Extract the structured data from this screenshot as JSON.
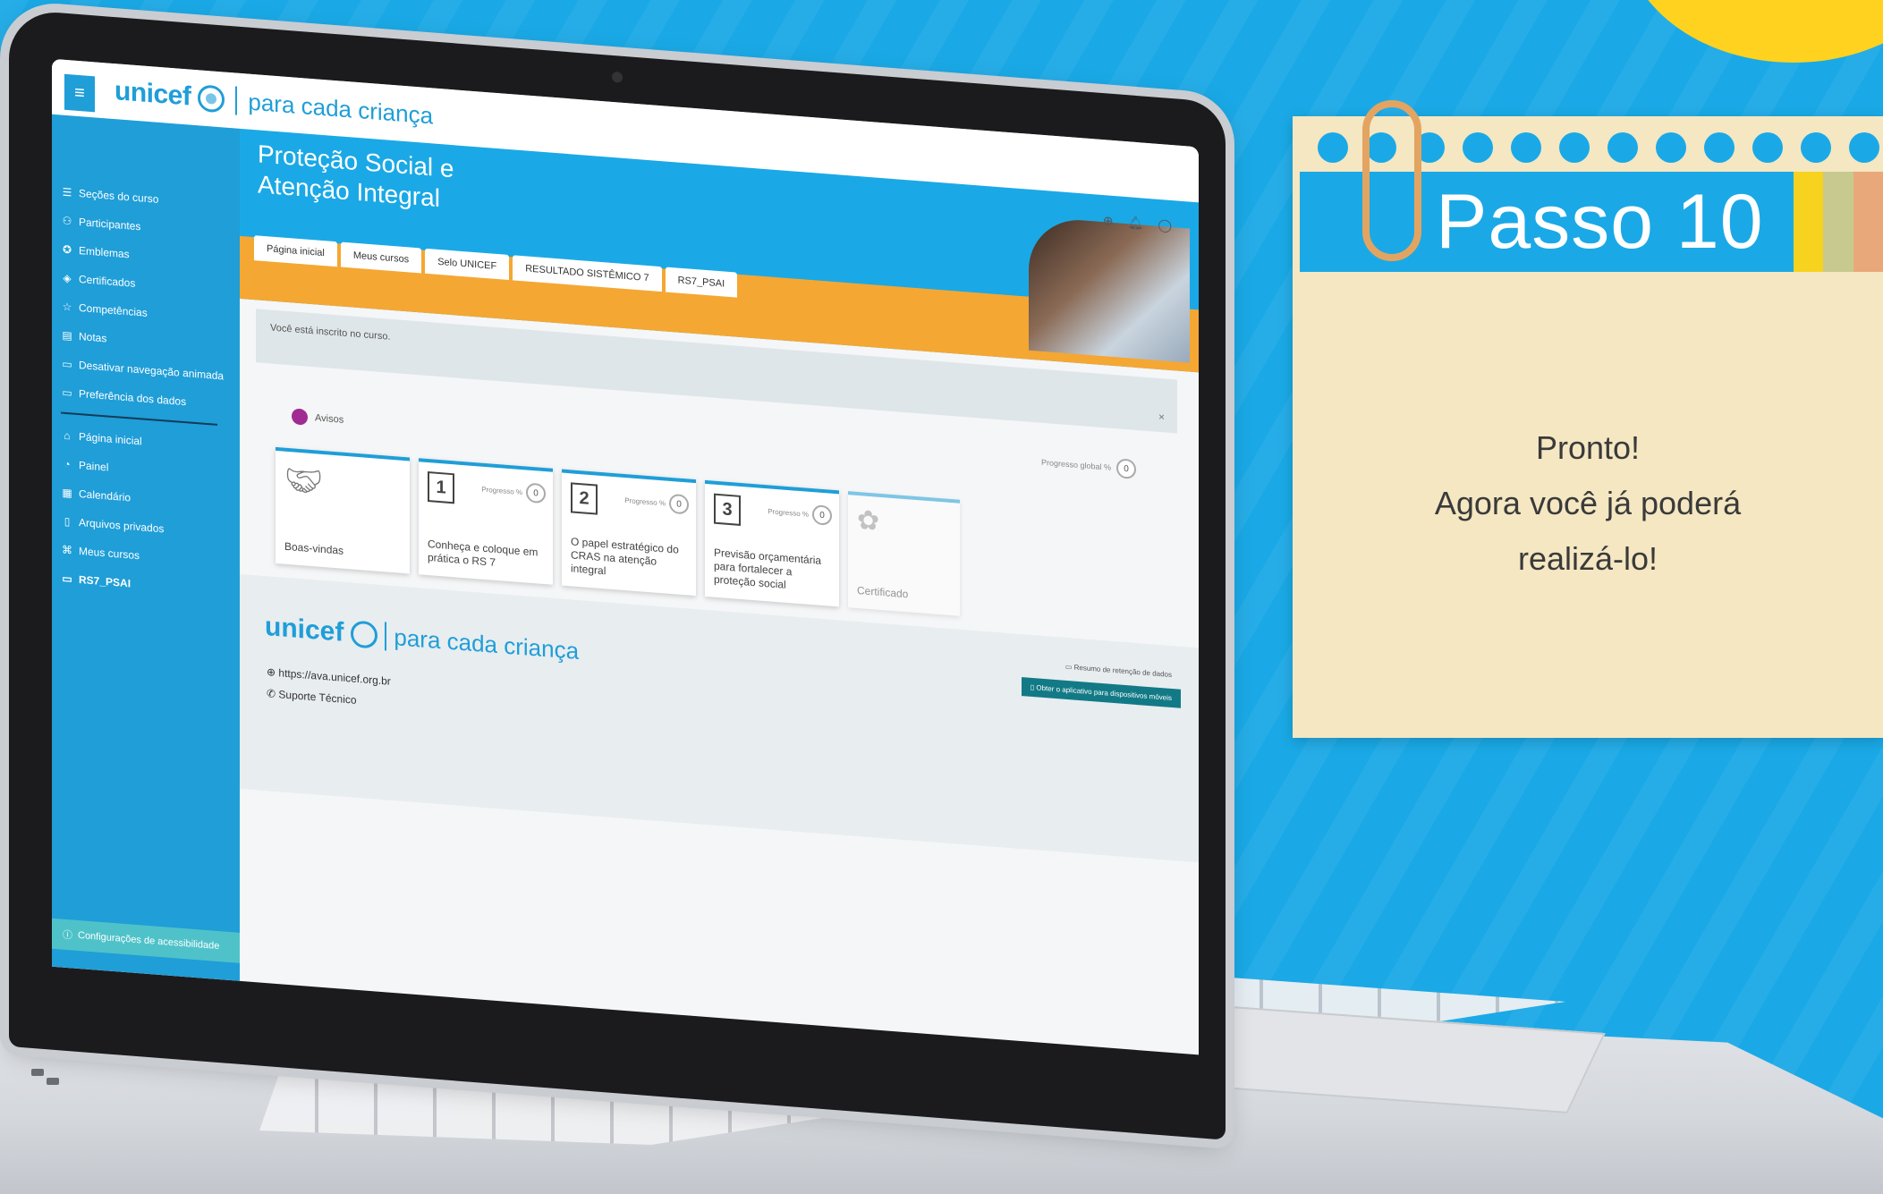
{
  "brand": {
    "name": "unicef",
    "tagline": "para cada criança"
  },
  "sidebar": {
    "items": [
      {
        "label": "Seções do curso",
        "icon": "list-icon"
      },
      {
        "label": "Participantes",
        "icon": "users-icon"
      },
      {
        "label": "Emblemas",
        "icon": "badge-icon"
      },
      {
        "label": "Certificados",
        "icon": "certificate-icon"
      },
      {
        "label": "Competências",
        "icon": "star-icon"
      },
      {
        "label": "Notas",
        "icon": "grades-icon"
      },
      {
        "label": "Desativar navegação animada",
        "icon": "folder-icon"
      },
      {
        "label": "Preferência dos dados",
        "icon": "folder-icon"
      },
      {
        "label": "Página inicial",
        "icon": "home-icon"
      },
      {
        "label": "Painel",
        "icon": "dashboard-icon"
      },
      {
        "label": "Calendário",
        "icon": "calendar-icon"
      },
      {
        "label": "Arquivos privados",
        "icon": "file-icon"
      },
      {
        "label": "Meus cursos",
        "icon": "graduation-cap-icon"
      },
      {
        "label": "RS7_PSAI",
        "icon": "folder-icon"
      }
    ],
    "accessibility": "Configurações de acessibilidade"
  },
  "banner": {
    "title": "Proteção Social e Atenção Integral",
    "tabs": [
      "Página inicial",
      "Meus cursos",
      "Selo UNICEF",
      "RESULTADO SISTÊMICO 7",
      "RS7_PSAI"
    ]
  },
  "notice": {
    "text": "Você está inscrito no curso.",
    "close": "×"
  },
  "progress_global": {
    "label": "Progresso global %",
    "value": "0"
  },
  "avisos": {
    "label": "Avisos"
  },
  "cards": [
    {
      "label": "Boas-vindas"
    },
    {
      "num": "1",
      "progress_label": "Progresso %",
      "progress": "0",
      "label": "Conheça e coloque em prática o RS 7"
    },
    {
      "num": "2",
      "progress_label": "Progresso %",
      "progress": "0",
      "label": "O papel estratégico do CRAS na atenção integral"
    },
    {
      "num": "3",
      "progress_label": "Progresso %",
      "progress": "0",
      "label": "Previsão orçamentária para fortalecer a proteção social"
    },
    {
      "label": "Certificado"
    }
  ],
  "footer": {
    "url": "https://ava.unicef.org.br",
    "support": "Suporte Técnico",
    "retention": "Resumo de retenção de dados",
    "app_button": "Obter o aplicativo para dispositivos móveis"
  },
  "note": {
    "title": "Passo 10",
    "line1": "Pronto!",
    "line2": "Agora você já poderá",
    "line3": "realizá-lo!",
    "stripe_colors": [
      "#f7d21e",
      "#c8c98e",
      "#e9a87a"
    ]
  }
}
